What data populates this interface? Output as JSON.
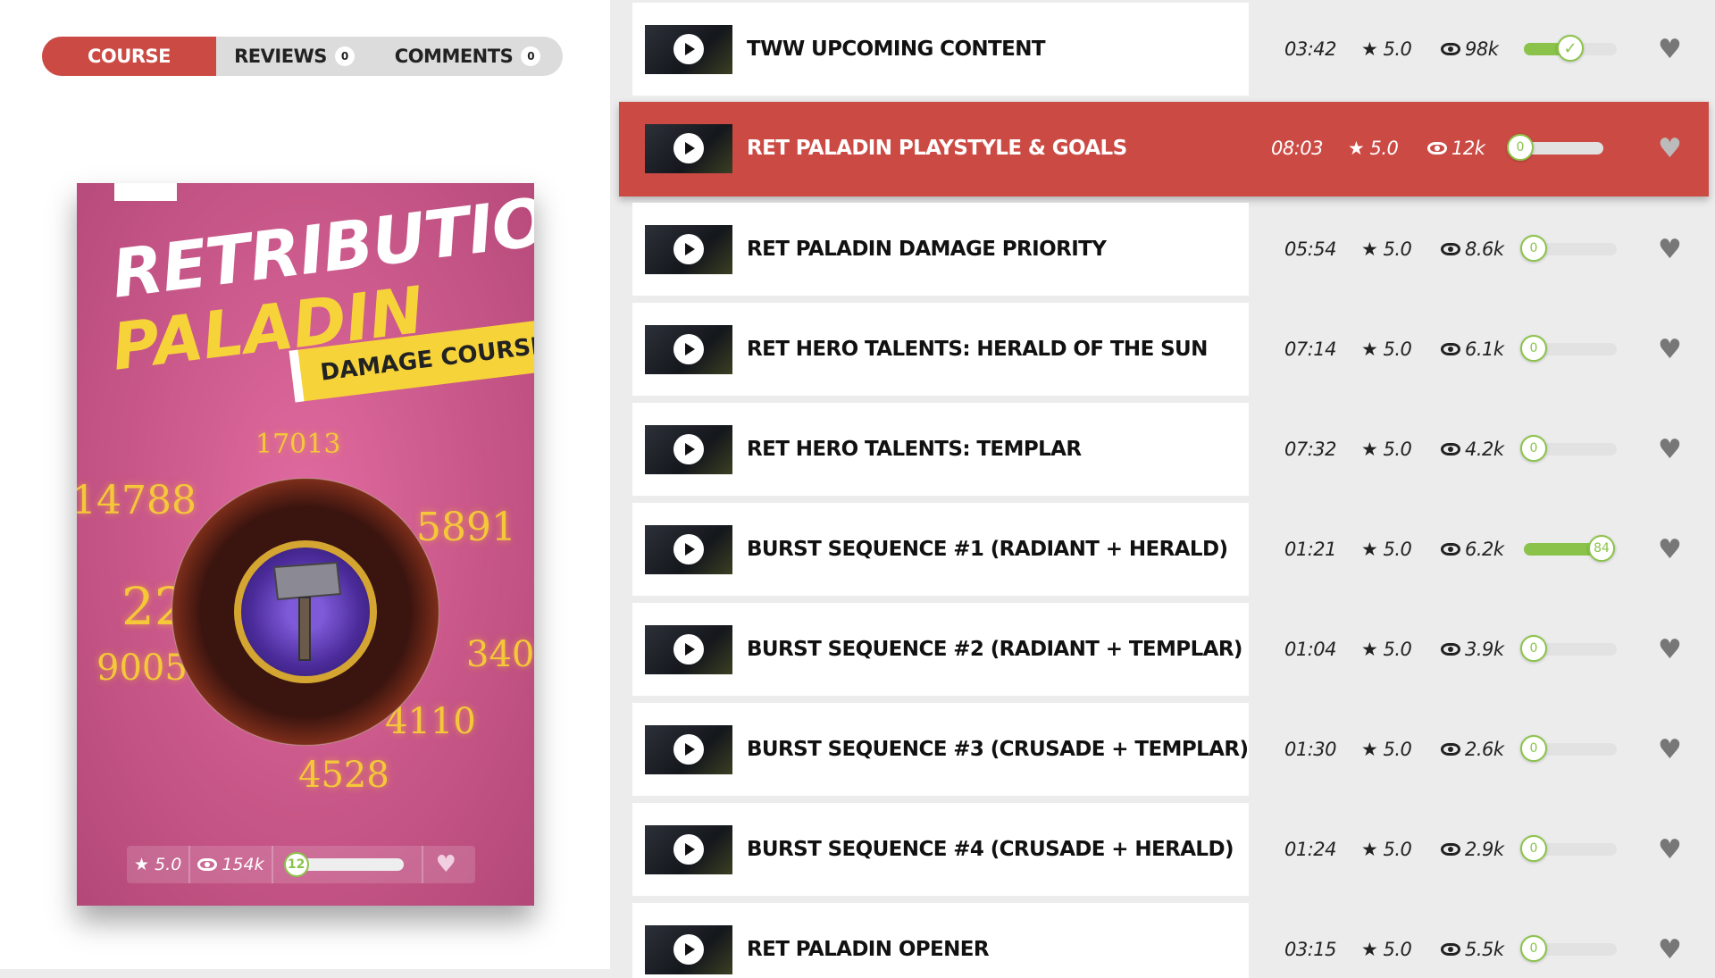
{
  "tabs": [
    {
      "label": "COURSE",
      "count": null
    },
    {
      "label": "REVIEWS",
      "count": "0"
    },
    {
      "label": "COMMENTS",
      "count": "0"
    }
  ],
  "cover": {
    "title1": "RETRIBUTION",
    "title2": "PALADIN",
    "banner": "DAMAGE COURSE",
    "numbers": [
      "17013",
      "14788",
      "5891",
      "22",
      "9005",
      "340",
      "4110",
      "4528"
    ],
    "rating": "5.0",
    "views": "154k",
    "progress_label": "12",
    "progress": 0.12
  },
  "colors": {
    "accent": "#cc4a44",
    "progress": "#8bc34a",
    "cover_bg": "#cc5a8c",
    "gold": "#f7d33a"
  },
  "lessons": [
    {
      "title": "TWW UPCOMING CONTENT",
      "duration": "03:42",
      "rating": "5.0",
      "views": "98k",
      "progress": 0.5,
      "knob": "✓",
      "active": false
    },
    {
      "title": "RET PALADIN PLAYSTYLE & GOALS",
      "duration": "08:03",
      "rating": "5.0",
      "views": "12k",
      "progress": 0,
      "knob": "0",
      "active": true
    },
    {
      "title": "RET PALADIN DAMAGE PRIORITY",
      "duration": "05:54",
      "rating": "5.0",
      "views": "8.6k",
      "progress": 0,
      "knob": "0",
      "active": false
    },
    {
      "title": "RET HERO TALENTS: HERALD OF THE SUN",
      "duration": "07:14",
      "rating": "5.0",
      "views": "6.1k",
      "progress": 0,
      "knob": "0",
      "active": false
    },
    {
      "title": "RET HERO TALENTS: TEMPLAR",
      "duration": "07:32",
      "rating": "5.0",
      "views": "4.2k",
      "progress": 0,
      "knob": "0",
      "active": false
    },
    {
      "title": "BURST SEQUENCE #1 (RADIANT + HERALD)",
      "duration": "01:21",
      "rating": "5.0",
      "views": "6.2k",
      "progress": 0.84,
      "knob": "84",
      "active": false
    },
    {
      "title": "BURST SEQUENCE #2 (RADIANT + TEMPLAR)",
      "duration": "01:04",
      "rating": "5.0",
      "views": "3.9k",
      "progress": 0,
      "knob": "0",
      "active": false
    },
    {
      "title": "BURST SEQUENCE #3 (CRUSADE + TEMPLAR)",
      "duration": "01:30",
      "rating": "5.0",
      "views": "2.6k",
      "progress": 0,
      "knob": "0",
      "active": false
    },
    {
      "title": "BURST SEQUENCE #4 (CRUSADE + HERALD)",
      "duration": "01:24",
      "rating": "5.0",
      "views": "2.9k",
      "progress": 0,
      "knob": "0",
      "active": false
    },
    {
      "title": "RET PALADIN OPENER",
      "duration": "03:15",
      "rating": "5.0",
      "views": "5.5k",
      "progress": 0,
      "knob": "0",
      "active": false
    }
  ]
}
